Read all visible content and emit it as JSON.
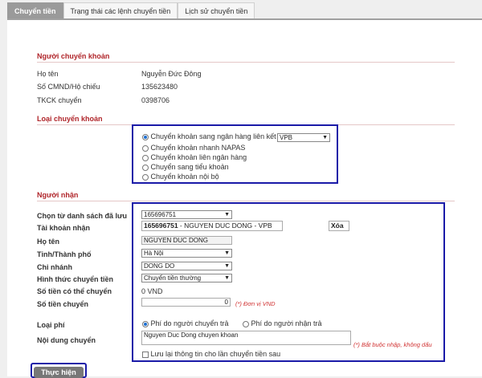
{
  "tabs": [
    {
      "label": "Chuyển tiền",
      "active": true
    },
    {
      "label": "Trạng thái các lệnh chuyển tiền",
      "active": false
    },
    {
      "label": "Lịch sử chuyển tiền",
      "active": false
    }
  ],
  "sender": {
    "title": "Người chuyển khoản",
    "name_label": "Họ tên",
    "name_value": "Nguyễn Đức Đông",
    "id_label": "Số CMND/Hộ chiếu",
    "id_value": "135623480",
    "acct_label": "TKCK chuyển",
    "acct_value": "0398706"
  },
  "transfer_type": {
    "title": "Loại chuyển khoản",
    "options": [
      {
        "label": "Chuyển khoản sang ngân hàng liên kết",
        "selected": true
      },
      {
        "label": "Chuyển khoản nhanh NAPAS",
        "selected": false
      },
      {
        "label": "Chuyển khoản liên ngân hàng",
        "selected": false
      },
      {
        "label": "Chuyển sang tiểu khoản",
        "selected": false
      },
      {
        "label": "Chuyển khoản nội bộ",
        "selected": false
      }
    ],
    "bank_select": "VPB"
  },
  "receiver": {
    "title": "Người nhận",
    "saved_list_label": "Chọn từ danh sách đã lưu",
    "saved_list_value": "165696751",
    "account_label": "Tài khoản nhận",
    "account_number": "165696751",
    "account_detail": " - NGUYEN DUC DONG - VPB",
    "delete_label": "Xóa",
    "name_label": "Họ tên",
    "name_value": "NGUYEN DUC DONG",
    "province_label": "Tỉnh/Thành phố",
    "province_value": "Hà Nội",
    "branch_label": "Chi nhánh",
    "branch_value": "DONG DO",
    "method_label": "Hình thức chuyển tiền",
    "method_value": "Chuyển tiền thường",
    "available_label": "Số tiền có thể chuyển",
    "available_value": "0 VND",
    "amount_label": "Số tiền chuyển",
    "amount_value": "0",
    "amount_note": "(*) Đơn vị VND",
    "fee_label": "Loại phí",
    "fee_options": [
      {
        "label": "Phí do người chuyển trả",
        "selected": true
      },
      {
        "label": "Phí do người nhận trả",
        "selected": false
      }
    ],
    "content_label": "Nội dung chuyển",
    "content_value": "Nguyen Duc Dong chuyen khoan",
    "content_note": "(*) Bắt buộc nhập, không dấu",
    "save_label": "Lưu lại thông tin cho lần chuyển tiền sau"
  },
  "submit_label": "Thực hiện",
  "colors": {
    "accent": "#b0252a",
    "highlight_box": "#1a1aa8",
    "radio": "#1e6fd0"
  }
}
